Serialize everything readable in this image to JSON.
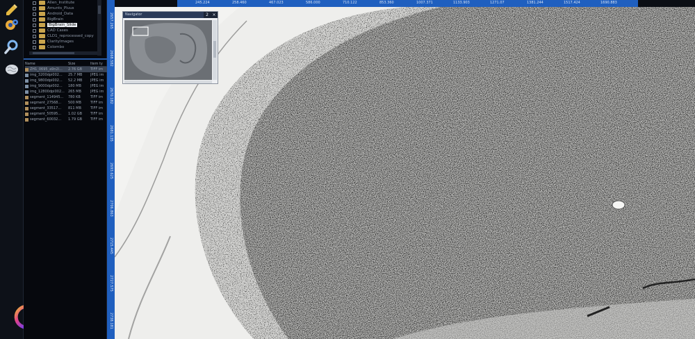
{
  "toolbar": {
    "tools": [
      {
        "icon": "pencil-icon"
      },
      {
        "icon": "gear-icon"
      },
      {
        "icon": "magnifier-icon"
      },
      {
        "icon": "brain-icon"
      }
    ],
    "brand_icon": "g-logo-icon",
    "colors": {
      "ruler": "#1f5fbf",
      "folder": "#c9a44d"
    }
  },
  "folder_tree": [
    {
      "label": "Allen_Institute"
    },
    {
      "label": "Amunts_Pluus"
    },
    {
      "label": "Android_Data"
    },
    {
      "label": "BigBrain"
    },
    {
      "label": "BigBrain_Slide",
      "selected": true
    },
    {
      "label": "CAD Cases"
    },
    {
      "label": "CLD1_reprocessed_copy"
    },
    {
      "label": "ClarityImages"
    },
    {
      "label": "Colombo"
    }
  ],
  "file_table": {
    "headers": [
      "Name",
      "Size",
      "Item ty"
    ],
    "rows": [
      {
        "name": "ZH1_0695_a9n2l...",
        "size": "2.76 GB",
        "type": "TIFF im",
        "icon": "tif",
        "selected": true
      },
      {
        "name": "img_3200dpi002...",
        "size": "25.7 MB",
        "type": "JPEG im",
        "icon": "jpg"
      },
      {
        "name": "img_9800dpi002...",
        "size": "52.2 MB",
        "type": "JPEG im",
        "icon": "jpg"
      },
      {
        "name": "img_9000dpi002...",
        "size": "180 MB",
        "type": "JPEG im",
        "icon": "jpg"
      },
      {
        "name": "img_12800dpi002...",
        "size": "265 MB",
        "type": "JPEG im",
        "icon": "jpg"
      },
      {
        "name": "segment_114945...",
        "size": "780 KB",
        "type": "TIFF im",
        "icon": "tif"
      },
      {
        "name": "segment_27568...",
        "size": "500 MB",
        "type": "TIFF im",
        "icon": "tif"
      },
      {
        "name": "segment_33517...",
        "size": "811 MB",
        "type": "TIFF im",
        "icon": "tif"
      },
      {
        "name": "segment_50595...",
        "size": "1.02 GB",
        "type": "TIFF im",
        "icon": "tif"
      },
      {
        "name": "segment_60032...",
        "size": "1.79 GB",
        "type": "TIFF im",
        "icon": "tif"
      }
    ]
  },
  "rulers": {
    "horizontal": [
      "245.224",
      "258.460",
      "467.023",
      "586.000",
      "710.122",
      "853.360",
      "1007.371",
      "1133.903",
      "1271.07",
      "1381.244",
      "1517.424",
      "1690.883"
    ],
    "vertical": [
      "2657.265",
      "2668.582",
      "2670.182",
      "2681.135",
      "2693.625",
      "2706.863",
      "2715.445",
      "2727.575",
      "2738.181"
    ]
  },
  "navigator": {
    "title": "Navigator",
    "badge": "2",
    "close": "×"
  }
}
